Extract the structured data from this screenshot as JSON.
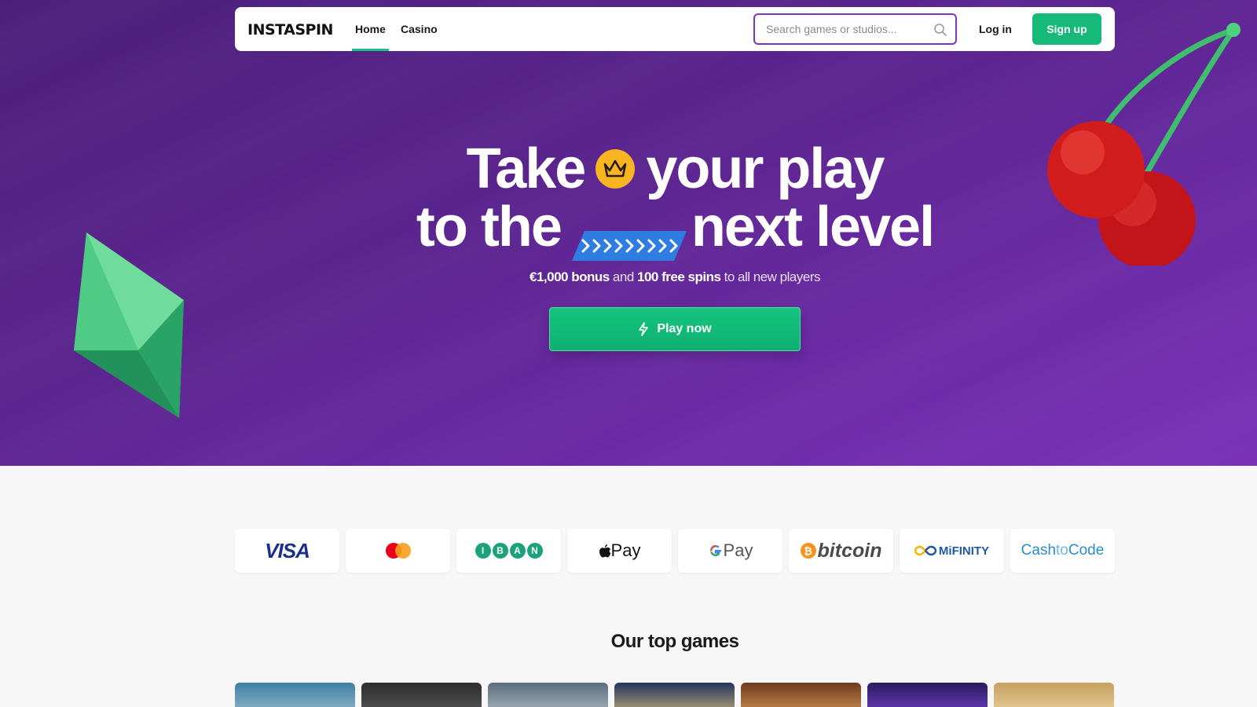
{
  "brand": {
    "logo_text": "INSTASPIN"
  },
  "nav": {
    "items": [
      {
        "label": "Home",
        "active": true
      },
      {
        "label": "Casino",
        "active": false
      }
    ],
    "search_placeholder": "Search games or studios...",
    "login_label": "Log in",
    "signup_label": "Sign up"
  },
  "hero": {
    "line1_a": "Take",
    "line1_b": "your play",
    "line2_a": "to the",
    "line2_b": "next level",
    "sub_bonus": "€1,000 bonus",
    "sub_and": " and ",
    "sub_spins": "100 free spins",
    "sub_rest": " to all new players",
    "cta_label": "Play now"
  },
  "payments": {
    "visa": "VISA",
    "iban": [
      "I",
      "B",
      "A",
      "N"
    ],
    "apple": "Pay",
    "google": "Pay",
    "bitcoin": "bitcoin",
    "bitcoin_coin": "₿",
    "mifinity": "MiFINITY",
    "cashtocode_a": "Cash",
    "cashtocode_b": "to",
    "cashtocode_c": "Code"
  },
  "top_games": {
    "title": "Our top games",
    "tile_colors": [
      "#4a7a9a",
      "#3a3a3a",
      "#5a6a7a",
      "#2a3a6a",
      "#7a4a2a",
      "#3a2a6a",
      "#c9a36a"
    ]
  },
  "colors": {
    "accent_green": "#17b978",
    "hero_purple": "#5c2490",
    "search_border": "#7a35c0"
  }
}
